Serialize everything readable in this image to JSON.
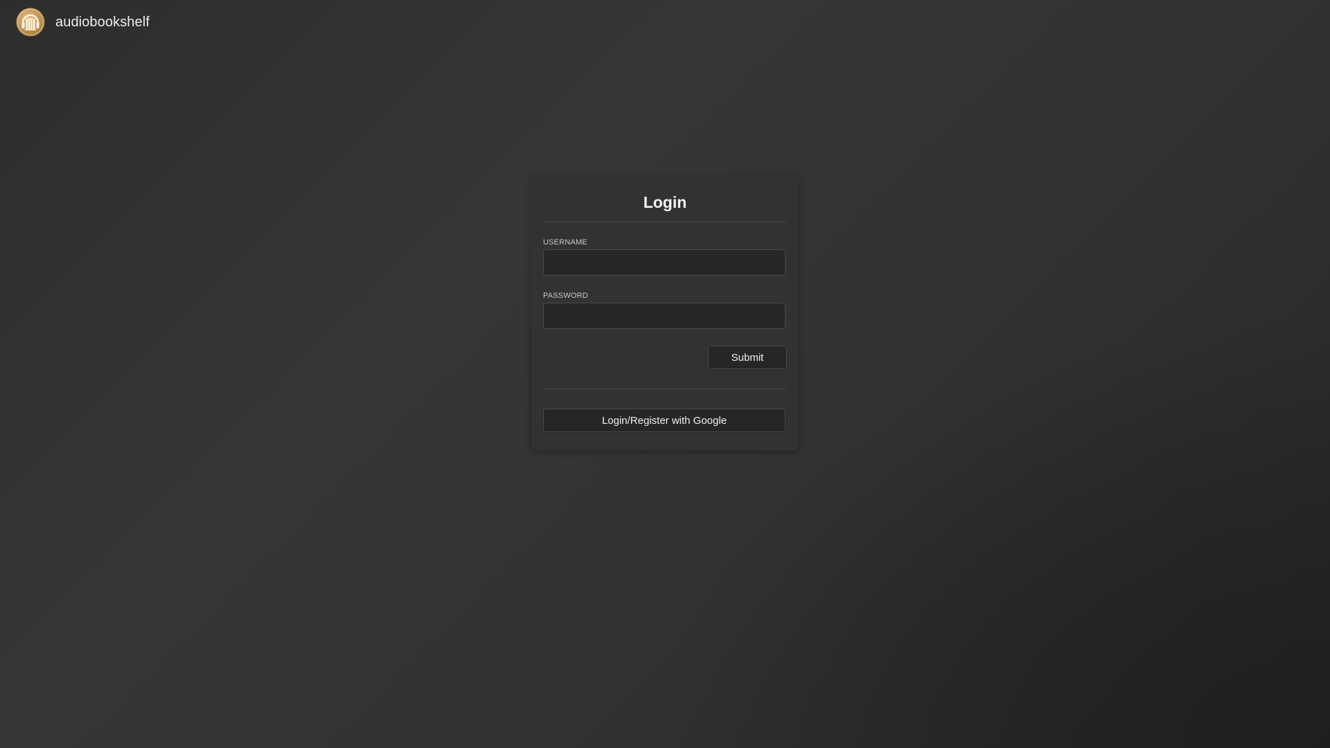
{
  "app": {
    "name": "audiobookshelf",
    "logo_icon": "audiobookshelf-logo-icon",
    "accent_color": "#c9a063"
  },
  "login": {
    "title": "Login",
    "username_label": "Username",
    "username_value": "",
    "password_label": "Password",
    "password_value": "",
    "submit_label": "Submit",
    "oauth_label": "Login/Register with Google"
  }
}
